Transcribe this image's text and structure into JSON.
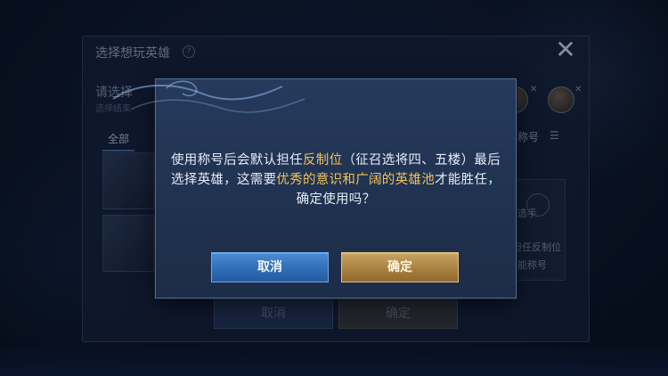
{
  "background": {
    "panel_title": "选择想玩英雄",
    "panel_subtitle": "请选择",
    "panel_subtitle_small": "选择结束",
    "tab_all": "全部",
    "filter_label": "使称号",
    "side_card_line1": "选手",
    "side_card_line2": "担任反制位",
    "side_card_line3": "能称号",
    "back_cancel_label": "取消",
    "back_confirm_label": "确定"
  },
  "dialog": {
    "message_part1": "使用称号后会默认担任",
    "message_highlight1": "反制位",
    "message_part2": "（征召选将四、五楼）最后选择英雄，这需要",
    "message_highlight2": "优秀的意识和广阔的英雄池",
    "message_part3": "才能胜任，确定使用吗？",
    "cancel_label": "取消",
    "confirm_label": "确定"
  },
  "colors": {
    "highlight": "#f3c35a",
    "cancel_button": "#2f6fb8",
    "confirm_button": "#a8823f"
  },
  "icons": {
    "close": "close-icon",
    "filter": "list-filter-icon",
    "help": "help-icon"
  }
}
